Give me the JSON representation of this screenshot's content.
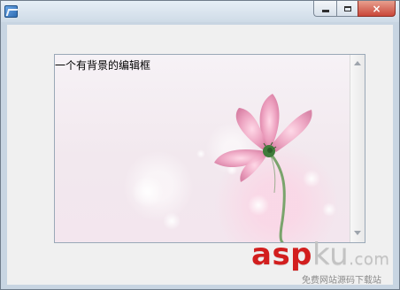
{
  "window": {
    "caption_buttons": {
      "minimize_label": "",
      "maximize_label": "",
      "close_label": "×"
    }
  },
  "editbox": {
    "text": "一个有背景的编辑框"
  },
  "watermark": {
    "logo_left": "asp",
    "logo_right": "ku",
    "logo_tld": ".com",
    "subtitle": "免费网站源码下载站"
  },
  "colors": {
    "window_frame": "#6f7c8a",
    "client_bg": "#f0f0f0",
    "edit_border": "#9aa8b7",
    "close_button": "#c9473a",
    "flower_pink": "#e6a4bd",
    "stem_green": "#3f7b3a"
  },
  "icons": {
    "app": "app-icon",
    "minimize": "minimize-icon",
    "maximize": "maximize-icon",
    "close": "close-icon",
    "scroll_up": "scroll-up-icon",
    "scroll_down": "scroll-down-icon"
  }
}
